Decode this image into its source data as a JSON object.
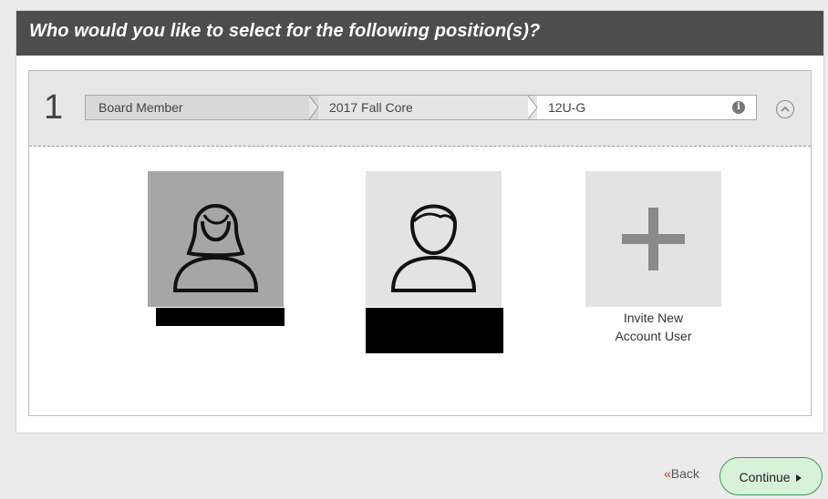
{
  "dialog": {
    "title": "Who would you like to select for the following position(s)?"
  },
  "position": {
    "number": "1",
    "breadcrumb": [
      "Board Member",
      "2017 Fall Core",
      "12U-G"
    ],
    "info_icon": "info-icon",
    "collapse_icon": "chevron-up-circle-icon"
  },
  "candidates": [
    {
      "avatar": "female-user-icon",
      "selected": true,
      "name": ""
    },
    {
      "avatar": "male-user-icon",
      "selected": false,
      "name": ""
    }
  ],
  "invite": {
    "icon": "plus-icon",
    "label_line1": "Invite New",
    "label_line2": "Account User"
  },
  "footer": {
    "back_chevrons": "«",
    "back_label": "Back",
    "continue_label": "Continue",
    "continue_icon": "caret-right-icon",
    "continue_color": "#d8f2d9",
    "continue_border": "#3a9a52"
  }
}
